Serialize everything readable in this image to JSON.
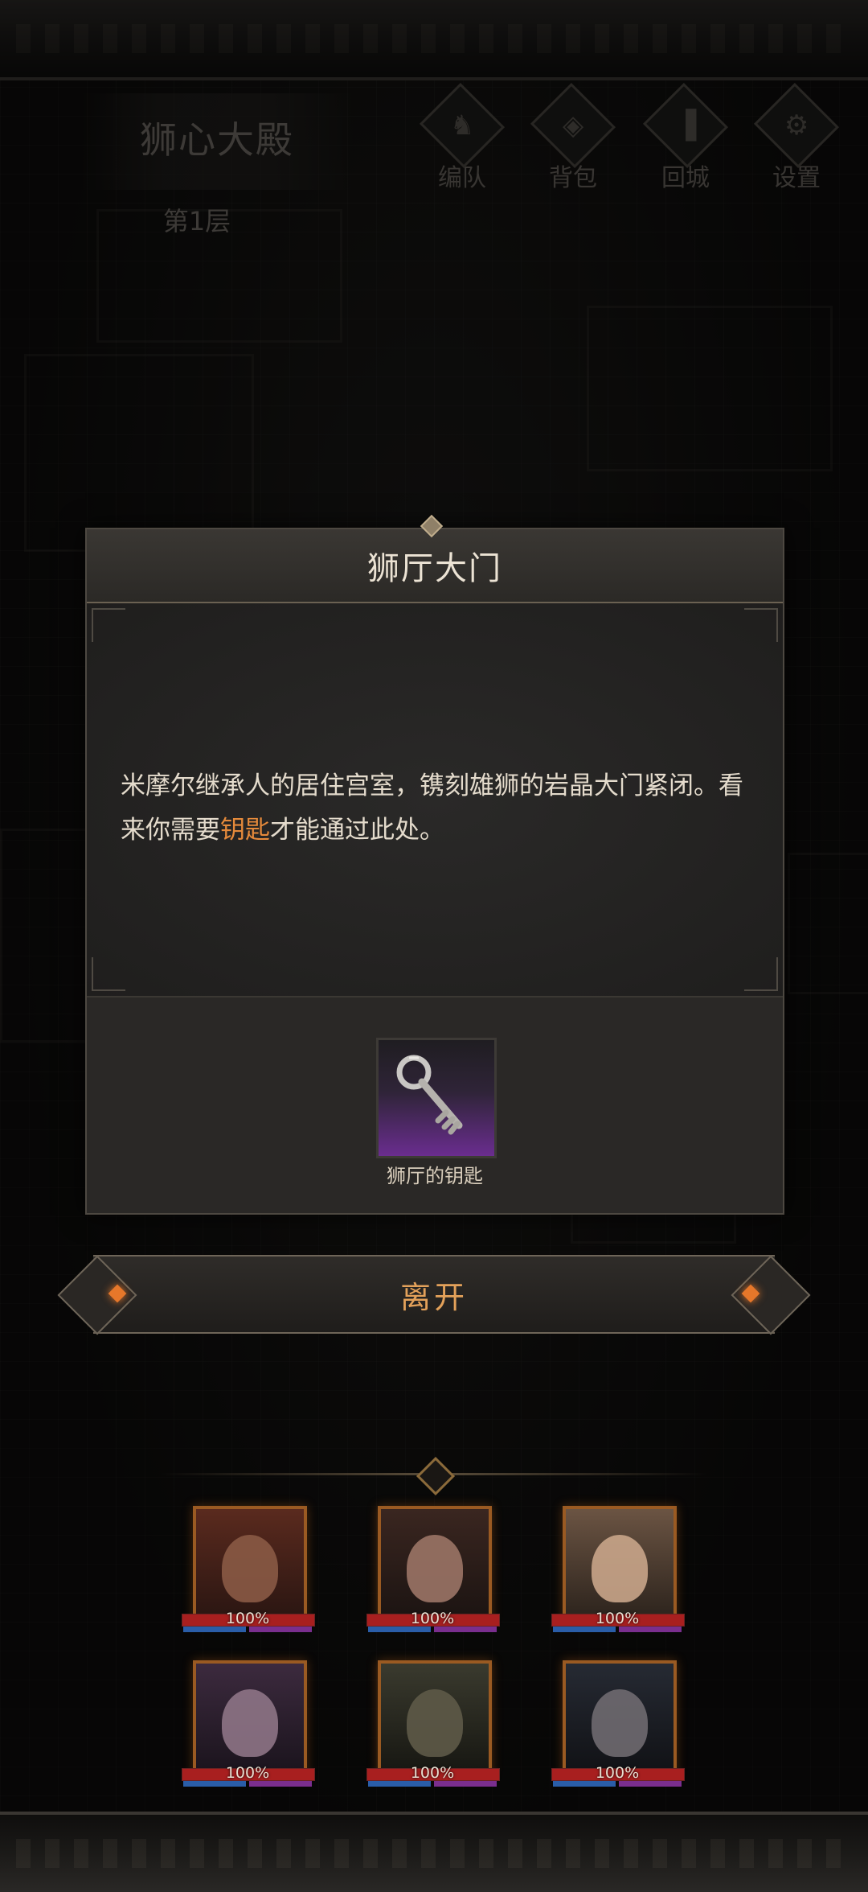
{
  "header": {
    "dungeon_name": "狮心大殿",
    "floor": "第1层",
    "buttons": [
      {
        "label": "编队",
        "icon": "horned-helmet-icon"
      },
      {
        "label": "背包",
        "icon": "bag-icon"
      },
      {
        "label": "回城",
        "icon": "door-icon"
      },
      {
        "label": "设置",
        "icon": "gear-icon"
      }
    ]
  },
  "dialog": {
    "title": "狮厅大门",
    "description_before": "米摩尔继承人的居住宫室，镌刻雄狮的岩晶大门紧闭。看来你需要",
    "description_highlight": "钥匙",
    "description_after": "才能通过此处。",
    "highlight_color": "#e58a3b",
    "item": {
      "name": "狮厅的钥匙",
      "icon": "key-icon",
      "rarity_color": "#6a2d8f"
    }
  },
  "leave_button": {
    "label": "离开"
  },
  "party": [
    {
      "hp_text": "100%",
      "hp": 1.0
    },
    {
      "hp_text": "100%",
      "hp": 1.0
    },
    {
      "hp_text": "100%",
      "hp": 1.0
    },
    {
      "hp_text": "100%",
      "hp": 1.0
    },
    {
      "hp_text": "100%",
      "hp": 1.0
    },
    {
      "hp_text": "100%",
      "hp": 1.0
    }
  ]
}
